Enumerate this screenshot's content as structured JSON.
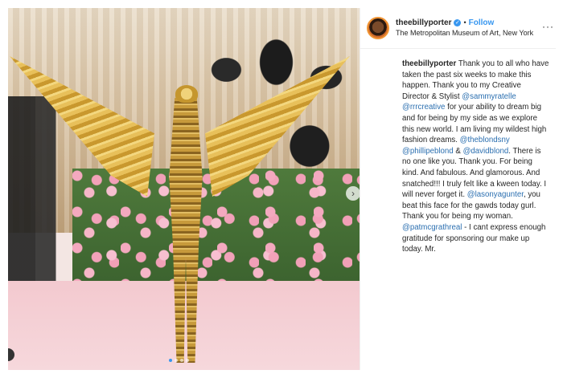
{
  "post": {
    "username": "theebillyporter",
    "verified_icon": "verified-badge-icon",
    "follow_label": "Follow",
    "separator": "•",
    "location": "The Metropolitan Museum of Art, New York",
    "more_icon": "more-options-icon",
    "more_glyph": "···"
  },
  "caption": {
    "username": "theebillyporter",
    "segments": [
      {
        "t": "text",
        "v": " Thank you to all who have taken the past six weeks to make this happen. Thank you to my Creative Director & Stylist "
      },
      {
        "t": "mention",
        "v": "@sammyratelle"
      },
      {
        "t": "text",
        "v": " "
      },
      {
        "t": "mention",
        "v": "@rrrcreative"
      },
      {
        "t": "text",
        "v": " for your ability to dream big and for being by my side as we explore this new world. I am living my wildest high fashion dreams. "
      },
      {
        "t": "mention",
        "v": "@theblondsny"
      },
      {
        "t": "text",
        "v": " "
      },
      {
        "t": "mention",
        "v": "@phillipeblond"
      },
      {
        "t": "text",
        "v": " & "
      },
      {
        "t": "mention",
        "v": "@davidblond"
      },
      {
        "t": "text",
        "v": ". There is no one like you. Thank you. For being kind. And fabulous. And glamorous. And snatched!!! I truly felt like a kween today. I will never forget it. "
      },
      {
        "t": "mention",
        "v": "@lasonyagunter"
      },
      {
        "t": "text",
        "v": ", you beat this face for the gawds today gurl. Thank you for being my woman. "
      },
      {
        "t": "mention",
        "v": "@patmcgrathreal"
      },
      {
        "t": "text",
        "v": " - I cant express enough gratitude for sponsoring our make up today. Mr."
      }
    ]
  },
  "carousel": {
    "count": 4,
    "active": 0,
    "next_glyph": "›"
  },
  "colors": {
    "accent": "#3897f0",
    "mention": "#2b6fb0"
  }
}
